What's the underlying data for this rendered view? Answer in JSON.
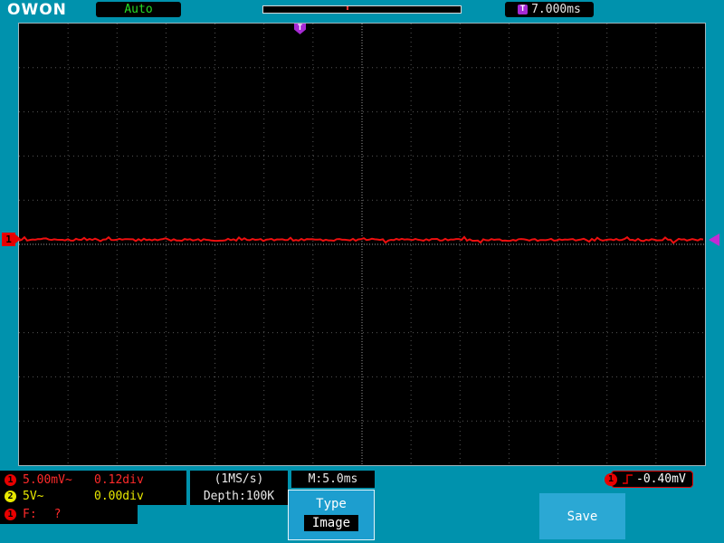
{
  "brand": "OWON",
  "statusbar_top": {
    "acquire_mode": "Auto",
    "trigger_icon": "T",
    "trigger_time": "7.000ms"
  },
  "screen": {
    "trigger_position_marker": "T",
    "channel1_marker": "1"
  },
  "channels": [
    {
      "badge": "1",
      "scale": "5.00mV~",
      "position": "0.12div"
    },
    {
      "badge": "2",
      "scale": "5V~",
      "position": "0.00div"
    }
  ],
  "frequency": {
    "badge": "1",
    "label": "F:",
    "value": "?"
  },
  "acquisition": {
    "sample_rate": "(1MS/s)",
    "depth": "Depth:100K"
  },
  "timebase": {
    "label": "M:5.0ms"
  },
  "trigger_info": {
    "badge": "1",
    "level": "-0.40mV"
  },
  "menu": {
    "type_label": "Type",
    "type_value": "Image",
    "save_label": "Save"
  },
  "colors": {
    "frame_teal": "#0092ad",
    "ch1_red": "#ff2a2a",
    "ch2_yellow": "#e8e800",
    "trigger_purple": "#c32ad4",
    "auto_green": "#27dd27"
  }
}
